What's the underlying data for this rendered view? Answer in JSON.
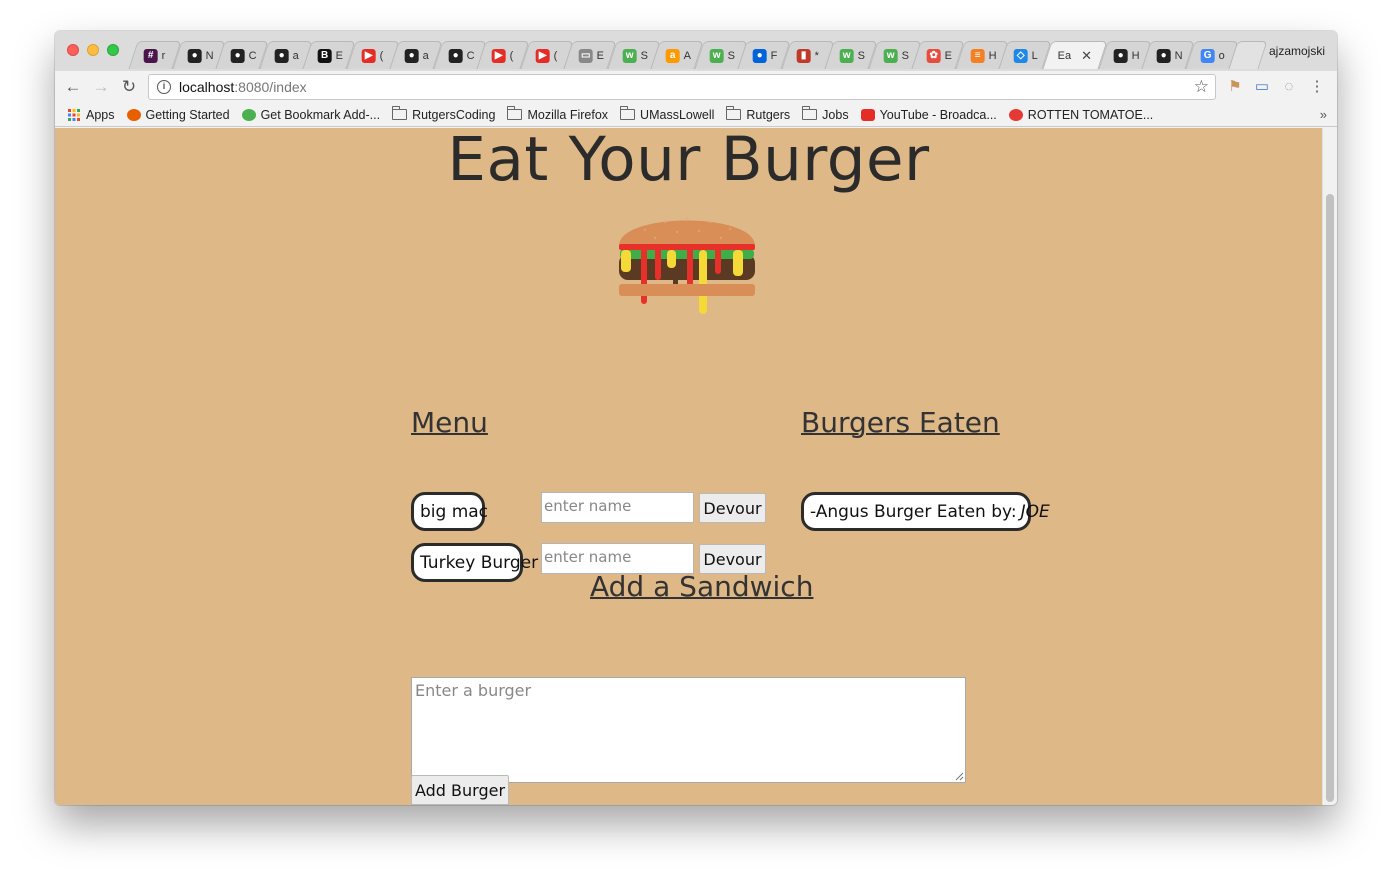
{
  "browser": {
    "tabs": [
      {
        "title": "r",
        "favicon": "slack-icon",
        "color": "#4a154b",
        "glyph": "#"
      },
      {
        "title": "N",
        "favicon": "github-icon",
        "color": "#222222",
        "glyph": "●"
      },
      {
        "title": "C",
        "favicon": "github-icon",
        "color": "#222222",
        "glyph": "●"
      },
      {
        "title": "a",
        "favicon": "github-icon",
        "color": "#222222",
        "glyph": "●"
      },
      {
        "title": "E",
        "favicon": "bootstrap-icon",
        "color": "#111111",
        "glyph": "B"
      },
      {
        "title": "(",
        "favicon": "youtube-icon",
        "color": "#e52d27",
        "glyph": "▶"
      },
      {
        "title": "a",
        "favicon": "github-icon",
        "color": "#222222",
        "glyph": "●"
      },
      {
        "title": "C",
        "favicon": "github-icon",
        "color": "#222222",
        "glyph": "●"
      },
      {
        "title": "(",
        "favicon": "youtube-icon",
        "color": "#e52d27",
        "glyph": "▶"
      },
      {
        "title": "(",
        "favicon": "youtube-icon",
        "color": "#e52d27",
        "glyph": "▶"
      },
      {
        "title": "E",
        "favicon": "document-icon",
        "color": "#888888",
        "glyph": "▭"
      },
      {
        "title": "S",
        "favicon": "w3schools-icon",
        "color": "#4caf50",
        "glyph": "w"
      },
      {
        "title": "A",
        "favicon": "amazon-icon",
        "color": "#ff9900",
        "glyph": "a"
      },
      {
        "title": "S",
        "favicon": "w3schools-icon",
        "color": "#4caf50",
        "glyph": "w"
      },
      {
        "title": "F",
        "favicon": "flickr-icon",
        "color": "#0063dc",
        "glyph": "●"
      },
      {
        "title": "*",
        "favicon": "trello-icon",
        "color": "#c0392b",
        "glyph": "▮"
      },
      {
        "title": "S",
        "favicon": "w3schools-icon",
        "color": "#4caf50",
        "glyph": "w"
      },
      {
        "title": "S",
        "favicon": "w3schools-icon",
        "color": "#4caf50",
        "glyph": "w"
      },
      {
        "title": "E",
        "favicon": "badge-icon",
        "color": "#e74c3c",
        "glyph": "✿"
      },
      {
        "title": "H",
        "favicon": "stackoverflow-icon",
        "color": "#f48024",
        "glyph": "≡"
      },
      {
        "title": "L",
        "favicon": "code-icon",
        "color": "#1e88e5",
        "glyph": "◇"
      },
      {
        "title": "E",
        "favicon": "none",
        "color": "#f2f2f2",
        "glyph": "",
        "active": true
      },
      {
        "title": "H",
        "favicon": "github-icon",
        "color": "#222222",
        "glyph": "●"
      },
      {
        "title": "N",
        "favicon": "github-icon",
        "color": "#222222",
        "glyph": "●"
      },
      {
        "title": "o",
        "favicon": "google-icon",
        "color": "#4285f4",
        "glyph": "G"
      }
    ],
    "active_tab_title": "Ea",
    "profile_name": "ajzamojski",
    "url_host": "localhost",
    "url_path": ":8080/index",
    "bookmarks": [
      {
        "label": "Apps",
        "icon": "apps-grid-icon"
      },
      {
        "label": "Getting Started",
        "icon": "firefox-icon"
      },
      {
        "label": "Get Bookmark Add-...",
        "icon": "puzzle-icon"
      },
      {
        "label": "RutgersCoding",
        "icon": "folder-icon"
      },
      {
        "label": "Mozilla Firefox",
        "icon": "folder-icon"
      },
      {
        "label": "UMassLowell",
        "icon": "folder-icon"
      },
      {
        "label": "Rutgers",
        "icon": "folder-icon"
      },
      {
        "label": "Jobs",
        "icon": "folder-icon"
      },
      {
        "label": "YouTube - Broadca...",
        "icon": "youtube-icon"
      },
      {
        "label": "ROTTEN TOMATOE...",
        "icon": "tomato-icon"
      }
    ],
    "overflow_chevron": "»"
  },
  "page": {
    "background": "#deb887",
    "title": "Eat Your Burger",
    "menu": {
      "heading": "Menu",
      "items": [
        {
          "name": "big mac",
          "input_placeholder": "enter name",
          "button": "Devour"
        },
        {
          "name": "Turkey Burger",
          "input_placeholder": "enter name",
          "button": "Devour"
        }
      ]
    },
    "eaten": {
      "heading": "Burgers Eaten",
      "items": [
        {
          "text": "-Angus Burger Eaten by:",
          "eater": "JOE"
        }
      ]
    },
    "add": {
      "heading": "Add a Sandwich",
      "textarea_placeholder": "Enter a burger",
      "button": "Add Burger"
    }
  }
}
